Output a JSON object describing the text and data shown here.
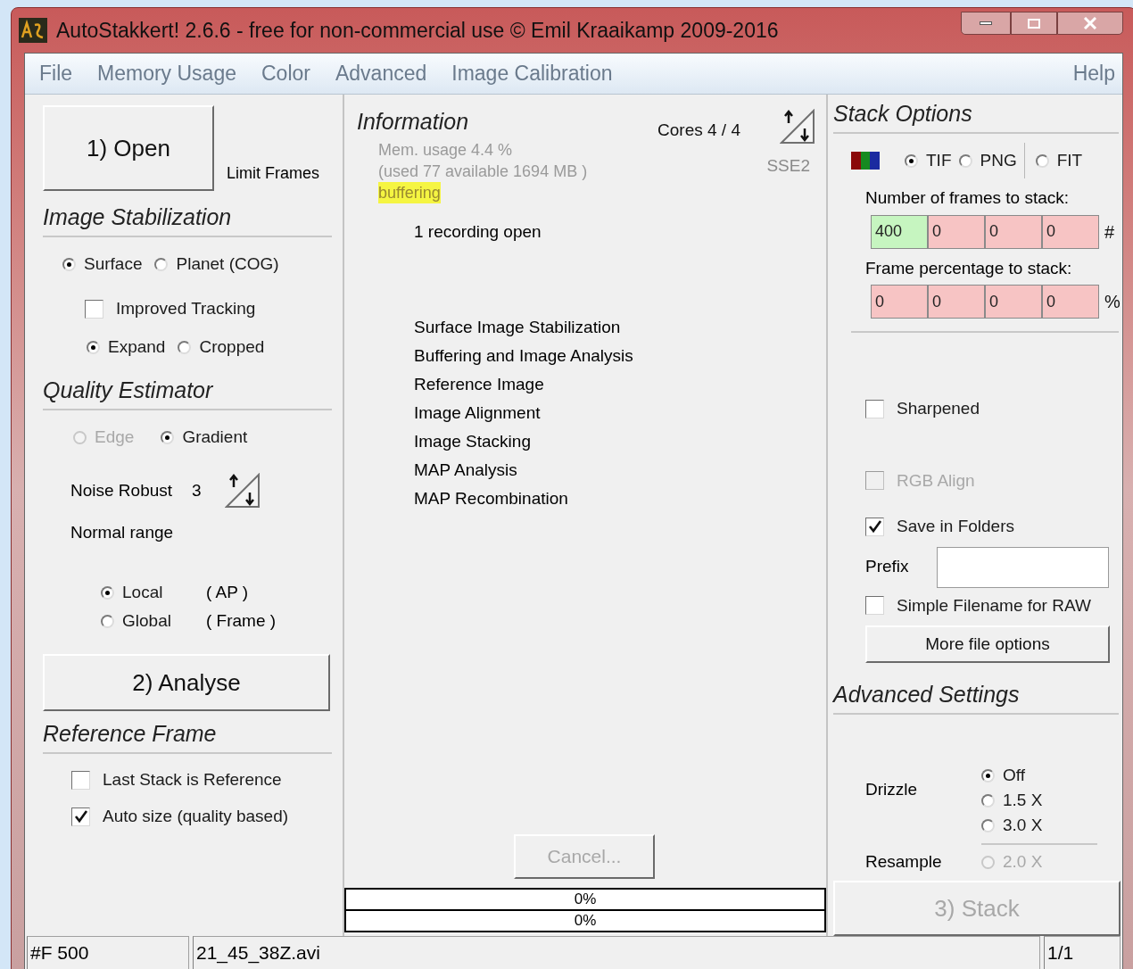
{
  "window": {
    "title": "AutoStakkert! 2.6.6 - free for non-commercial use © Emil Kraaikamp 2009-2016"
  },
  "menu": [
    {
      "label": "File"
    },
    {
      "label": "Memory Usage"
    },
    {
      "label": "Color"
    },
    {
      "label": "Advanced"
    },
    {
      "label": "Image Calibration"
    }
  ],
  "help_menu": {
    "label": "Help"
  },
  "left": {
    "open_button": "1) Open",
    "limit_frames": "Limit Frames",
    "stabilization": {
      "title": "Image Stabilization",
      "mode": [
        {
          "label": "Surface",
          "selected": true,
          "disabled": false
        },
        {
          "label": "Planet (COG)",
          "selected": false,
          "disabled": false
        }
      ],
      "improved_tracking": {
        "label": "Improved Tracking",
        "checked": false,
        "disabled": false
      },
      "frame": [
        {
          "label": "Expand",
          "selected": true,
          "disabled": false
        },
        {
          "label": "Cropped",
          "selected": false,
          "disabled": false
        }
      ]
    },
    "quality": {
      "title": "Quality Estimator",
      "method": [
        {
          "label": "Edge",
          "selected": false,
          "disabled": true
        },
        {
          "label": "Gradient",
          "selected": true,
          "disabled": false
        }
      ],
      "noise_robust": "Noise Robust",
      "noise_value": "3",
      "range": "Normal range",
      "scope": [
        {
          "label": "Local",
          "note": "( AP )",
          "selected": true,
          "disabled": false
        },
        {
          "label": "Global",
          "note": "( Frame )",
          "selected": false,
          "disabled": false
        }
      ]
    },
    "analyse_button": "2) Analyse",
    "reference": {
      "title": "Reference Frame",
      "options": [
        {
          "label": "Last Stack is Reference",
          "checked": false,
          "disabled": false
        },
        {
          "label": "Auto size (quality based)",
          "checked": true,
          "disabled": false
        }
      ]
    }
  },
  "info": {
    "title": "Information",
    "cores": "Cores 4 / 4",
    "memory": [
      "Mem. usage 4.4 %",
      "(used 77 available 1694 MB )"
    ],
    "status": "buffering",
    "sse": "SSE2",
    "recording": "1 recording open",
    "steps": [
      "Surface Image Stabilization",
      "Buffering and Image Analysis",
      "Reference Image",
      "Image Alignment",
      "Image Stacking",
      "MAP Analysis",
      "MAP Recombination"
    ],
    "cancel_button": {
      "label": "Cancel...",
      "disabled": true
    },
    "progress": [
      {
        "text": "0%",
        "level": 0
      },
      {
        "text": "0%",
        "level": 0
      }
    ]
  },
  "stack": {
    "title": "Stack Options",
    "formats": [
      {
        "label": "TIF",
        "selected": true,
        "disabled": false
      },
      {
        "label": "PNG",
        "selected": false,
        "disabled": false
      },
      {
        "label": "FIT",
        "selected": false,
        "disabled": false
      }
    ],
    "frames_label": "Number of frames to stack:",
    "frames": [
      {
        "value": "400",
        "color": "#c6f5c0"
      },
      {
        "value": "0",
        "color": "#f7c4c4"
      },
      {
        "value": "0",
        "color": "#f7c4c4"
      },
      {
        "value": "0",
        "color": "#f7c4c4"
      }
    ],
    "frames_unit": "#",
    "percent_label": "Frame percentage to stack:",
    "percent": [
      {
        "value": "0",
        "color": "#f7c4c4"
      },
      {
        "value": "0",
        "color": "#f7c4c4"
      },
      {
        "value": "0",
        "color": "#f7c4c4"
      },
      {
        "value": "0",
        "color": "#f7c4c4"
      }
    ],
    "percent_unit": "%",
    "options": [
      {
        "label": "Sharpened",
        "checked": false,
        "disabled": false
      },
      {
        "label": "RGB Align",
        "checked": false,
        "disabled": true
      },
      {
        "label": "Save in Folders",
        "checked": true,
        "disabled": false
      }
    ],
    "prefix": {
      "label": "Prefix"
    },
    "simple_filename": {
      "label": "Simple Filename for RAW",
      "checked": false,
      "disabled": false
    },
    "more_button": "More file options"
  },
  "advanced": {
    "title": "Advanced Settings",
    "drizzle_label": "Drizzle",
    "drizzle": [
      {
        "label": "Off",
        "selected": true,
        "disabled": false
      },
      {
        "label": "1.5 X",
        "selected": false,
        "disabled": false
      },
      {
        "label": "3.0 X",
        "selected": false,
        "disabled": false
      }
    ],
    "resample_label": "Resample",
    "resample": [
      {
        "label": "2.0 X",
        "selected": false,
        "disabled": true
      }
    ],
    "stack_button": {
      "label": "3) Stack",
      "disabled": true
    }
  },
  "status_bar": [
    "#F 500",
    "21_45_38Z.avi",
    "1/1"
  ]
}
